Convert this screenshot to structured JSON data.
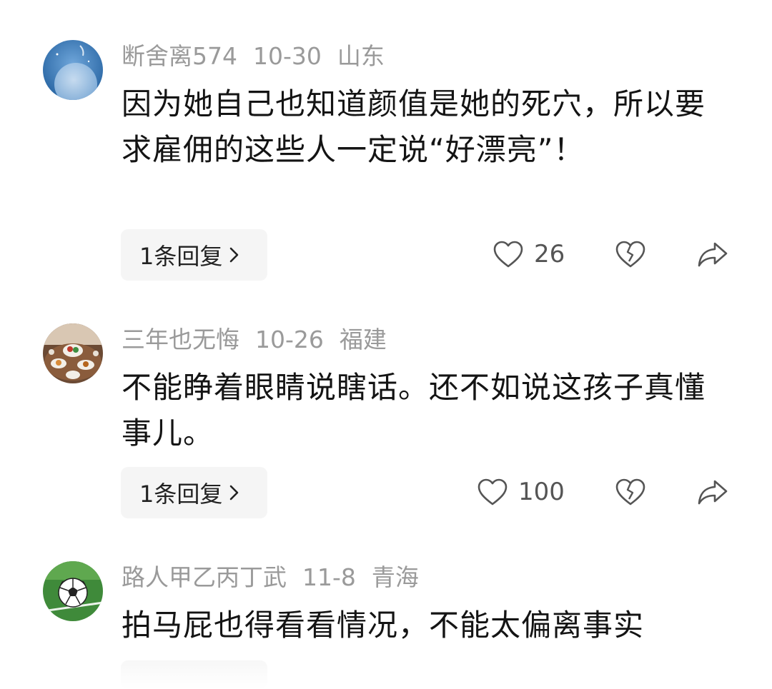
{
  "comments": [
    {
      "username": "断舍离574",
      "date": "10-30",
      "location": "山东",
      "text": "因为她自己也知道颜值是她的死穴，所以要求雇佣的这些人一定说“好漂亮”！",
      "reply_label": "1条回复",
      "likes": "26",
      "avatar_icon": "moon-night-avatar"
    },
    {
      "username": "三年也无悔",
      "date": "10-26",
      "location": "福建",
      "text": "不能睁着眼睛说瞎话。还不如说这孩子真懂事儿。",
      "reply_label": "1条回复",
      "likes": "100",
      "avatar_icon": "food-table-avatar"
    },
    {
      "username": "路人甲乙丙丁武",
      "date": "11-8",
      "location": "青海",
      "text": "拍马屁也得看看情况，不能太偏离事实",
      "avatar_icon": "soccer-ball-avatar"
    }
  ],
  "icons": {
    "like": "heart-outline-icon",
    "dislike": "broken-heart-icon",
    "share": "share-arrow-icon",
    "chevron": "chevron-right-icon"
  },
  "colors": {
    "meta_text": "#9a9a9a",
    "body_text": "#141414",
    "reply_bg": "#f5f5f5",
    "icon_stroke": "#555555"
  }
}
